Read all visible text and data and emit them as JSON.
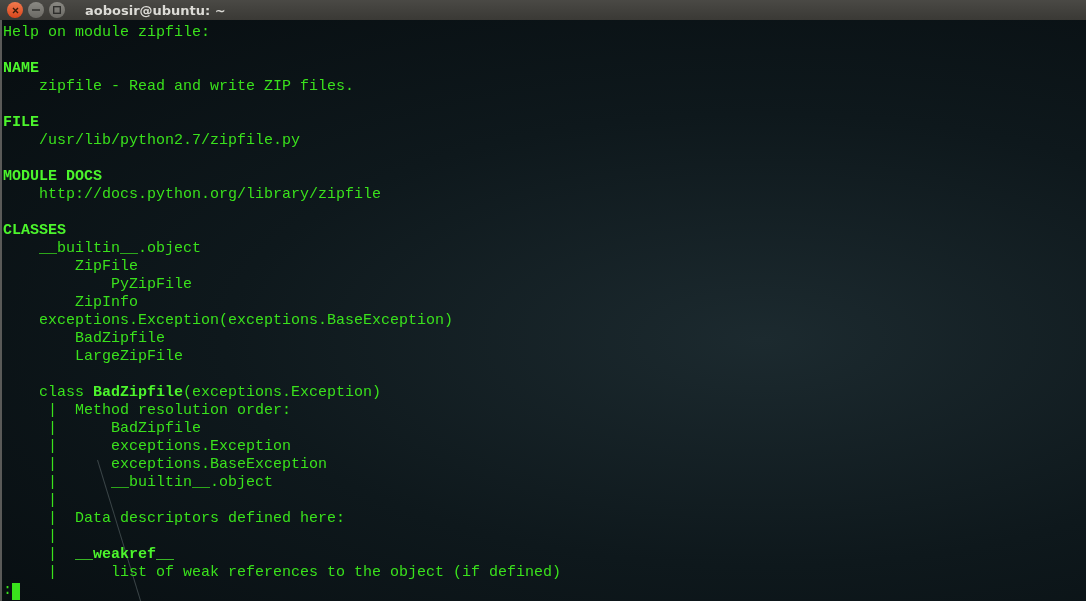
{
  "window": {
    "title": "aobosir@ubuntu: ~"
  },
  "lines": [
    {
      "kind": "text",
      "text": "Help on module zipfile:"
    },
    {
      "kind": "blank"
    },
    {
      "kind": "heading",
      "text": "NAME"
    },
    {
      "kind": "text",
      "text": "    zipfile - Read and write ZIP files."
    },
    {
      "kind": "blank"
    },
    {
      "kind": "heading",
      "text": "FILE"
    },
    {
      "kind": "text",
      "text": "    /usr/lib/python2.7/zipfile.py"
    },
    {
      "kind": "blank"
    },
    {
      "kind": "heading",
      "text": "MODULE DOCS"
    },
    {
      "kind": "text",
      "text": "    http://docs.python.org/library/zipfile"
    },
    {
      "kind": "blank"
    },
    {
      "kind": "heading",
      "text": "CLASSES"
    },
    {
      "kind": "text",
      "text": "    __builtin__.object"
    },
    {
      "kind": "text",
      "text": "        ZipFile"
    },
    {
      "kind": "text",
      "text": "            PyZipFile"
    },
    {
      "kind": "text",
      "text": "        ZipInfo"
    },
    {
      "kind": "text",
      "text": "    exceptions.Exception(exceptions.BaseException)"
    },
    {
      "kind": "text",
      "text": "        BadZipfile"
    },
    {
      "kind": "text",
      "text": "        LargeZipFile"
    },
    {
      "kind": "blank"
    },
    {
      "kind": "text",
      "text": "    class **BadZipfile**(exceptions.Exception)"
    },
    {
      "kind": "text",
      "text": "     |  Method resolution order:"
    },
    {
      "kind": "text",
      "text": "     |      BadZipfile"
    },
    {
      "kind": "text",
      "text": "     |      exceptions.Exception"
    },
    {
      "kind": "text",
      "text": "     |      exceptions.BaseException"
    },
    {
      "kind": "text",
      "text": "     |      __builtin__.object"
    },
    {
      "kind": "text",
      "text": "     |"
    },
    {
      "kind": "text",
      "text": "     |  Data descriptors defined here:"
    },
    {
      "kind": "text",
      "text": "     |"
    },
    {
      "kind": "text",
      "text": "     |  **__weakref__**"
    },
    {
      "kind": "text",
      "text": "     |      list of weak references to the object (if defined)"
    }
  ],
  "prompt": {
    "text": ":"
  }
}
